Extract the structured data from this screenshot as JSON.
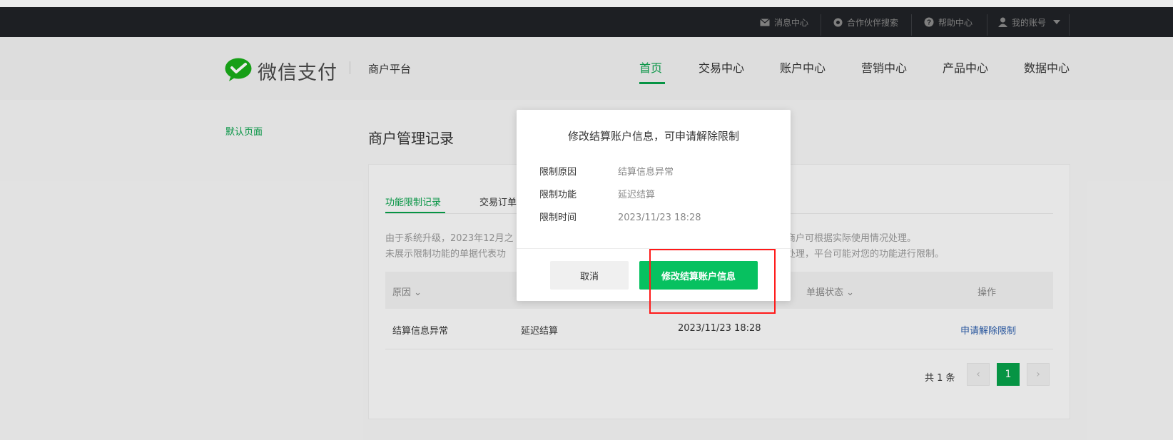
{
  "topbar": {
    "messages": "消息中心",
    "partner_search": "合作伙伴搜索",
    "help": "帮助中心",
    "account": "我的账号"
  },
  "header": {
    "logo_text": "微信支付",
    "subtitle": "商户平台",
    "nav": [
      "首页",
      "交易中心",
      "账户中心",
      "营销中心",
      "产品中心",
      "数据中心"
    ],
    "active_nav": "首页"
  },
  "sidebar": {
    "default_page": "默认页面"
  },
  "main": {
    "title": "商户管理记录",
    "tabs": [
      "功能限制记录",
      "交易订单"
    ],
    "notice_line1": "由于系统升级，2023年12月之",
    "notice_line1_tail": "，商户可根据实际使用情况处理。",
    "notice_line2": "未展示限制功能的单据代表功",
    "notice_line2_tail": "处理，平台可能对您的功能进行限制。",
    "table": {
      "headers": [
        "原因",
        "单据状态",
        "操作"
      ],
      "rows": [
        {
          "reason": "结算信息异常",
          "function": "延迟结算",
          "time": "2023/11/23 18:28",
          "action": "申请解除限制"
        }
      ]
    },
    "pagination": {
      "total": "共 1 条",
      "current": "1",
      "prev": "‹",
      "next": "›"
    }
  },
  "dialog": {
    "title": "修改结算账户信息，可申请解除限制",
    "items": [
      {
        "label": "限制原因",
        "value": "结算信息异常"
      },
      {
        "label": "限制功能",
        "value": "延迟结算"
      },
      {
        "label": "限制时间",
        "value": "2023/11/23 18:28"
      }
    ],
    "cancel": "取消",
    "confirm": "修改结算账户信息"
  },
  "colors": {
    "brand_green": "#07a14a",
    "button_green": "#07c160",
    "highlight_red": "#ff1a1a",
    "link_blue": "#2a5caa"
  }
}
